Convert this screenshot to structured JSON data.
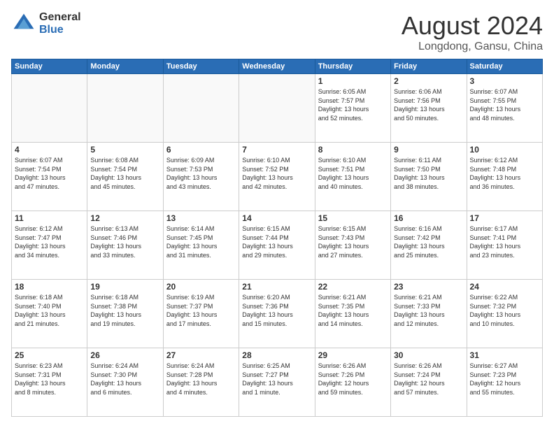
{
  "logo": {
    "general": "General",
    "blue": "Blue"
  },
  "header": {
    "month": "August 2024",
    "location": "Longdong, Gansu, China"
  },
  "weekdays": [
    "Sunday",
    "Monday",
    "Tuesday",
    "Wednesday",
    "Thursday",
    "Friday",
    "Saturday"
  ],
  "weeks": [
    [
      {
        "day": "",
        "info": ""
      },
      {
        "day": "",
        "info": ""
      },
      {
        "day": "",
        "info": ""
      },
      {
        "day": "",
        "info": ""
      },
      {
        "day": "1",
        "info": "Sunrise: 6:05 AM\nSunset: 7:57 PM\nDaylight: 13 hours\nand 52 minutes."
      },
      {
        "day": "2",
        "info": "Sunrise: 6:06 AM\nSunset: 7:56 PM\nDaylight: 13 hours\nand 50 minutes."
      },
      {
        "day": "3",
        "info": "Sunrise: 6:07 AM\nSunset: 7:55 PM\nDaylight: 13 hours\nand 48 minutes."
      }
    ],
    [
      {
        "day": "4",
        "info": "Sunrise: 6:07 AM\nSunset: 7:54 PM\nDaylight: 13 hours\nand 47 minutes."
      },
      {
        "day": "5",
        "info": "Sunrise: 6:08 AM\nSunset: 7:54 PM\nDaylight: 13 hours\nand 45 minutes."
      },
      {
        "day": "6",
        "info": "Sunrise: 6:09 AM\nSunset: 7:53 PM\nDaylight: 13 hours\nand 43 minutes."
      },
      {
        "day": "7",
        "info": "Sunrise: 6:10 AM\nSunset: 7:52 PM\nDaylight: 13 hours\nand 42 minutes."
      },
      {
        "day": "8",
        "info": "Sunrise: 6:10 AM\nSunset: 7:51 PM\nDaylight: 13 hours\nand 40 minutes."
      },
      {
        "day": "9",
        "info": "Sunrise: 6:11 AM\nSunset: 7:50 PM\nDaylight: 13 hours\nand 38 minutes."
      },
      {
        "day": "10",
        "info": "Sunrise: 6:12 AM\nSunset: 7:48 PM\nDaylight: 13 hours\nand 36 minutes."
      }
    ],
    [
      {
        "day": "11",
        "info": "Sunrise: 6:12 AM\nSunset: 7:47 PM\nDaylight: 13 hours\nand 34 minutes."
      },
      {
        "day": "12",
        "info": "Sunrise: 6:13 AM\nSunset: 7:46 PM\nDaylight: 13 hours\nand 33 minutes."
      },
      {
        "day": "13",
        "info": "Sunrise: 6:14 AM\nSunset: 7:45 PM\nDaylight: 13 hours\nand 31 minutes."
      },
      {
        "day": "14",
        "info": "Sunrise: 6:15 AM\nSunset: 7:44 PM\nDaylight: 13 hours\nand 29 minutes."
      },
      {
        "day": "15",
        "info": "Sunrise: 6:15 AM\nSunset: 7:43 PM\nDaylight: 13 hours\nand 27 minutes."
      },
      {
        "day": "16",
        "info": "Sunrise: 6:16 AM\nSunset: 7:42 PM\nDaylight: 13 hours\nand 25 minutes."
      },
      {
        "day": "17",
        "info": "Sunrise: 6:17 AM\nSunset: 7:41 PM\nDaylight: 13 hours\nand 23 minutes."
      }
    ],
    [
      {
        "day": "18",
        "info": "Sunrise: 6:18 AM\nSunset: 7:40 PM\nDaylight: 13 hours\nand 21 minutes."
      },
      {
        "day": "19",
        "info": "Sunrise: 6:18 AM\nSunset: 7:38 PM\nDaylight: 13 hours\nand 19 minutes."
      },
      {
        "day": "20",
        "info": "Sunrise: 6:19 AM\nSunset: 7:37 PM\nDaylight: 13 hours\nand 17 minutes."
      },
      {
        "day": "21",
        "info": "Sunrise: 6:20 AM\nSunset: 7:36 PM\nDaylight: 13 hours\nand 15 minutes."
      },
      {
        "day": "22",
        "info": "Sunrise: 6:21 AM\nSunset: 7:35 PM\nDaylight: 13 hours\nand 14 minutes."
      },
      {
        "day": "23",
        "info": "Sunrise: 6:21 AM\nSunset: 7:33 PM\nDaylight: 13 hours\nand 12 minutes."
      },
      {
        "day": "24",
        "info": "Sunrise: 6:22 AM\nSunset: 7:32 PM\nDaylight: 13 hours\nand 10 minutes."
      }
    ],
    [
      {
        "day": "25",
        "info": "Sunrise: 6:23 AM\nSunset: 7:31 PM\nDaylight: 13 hours\nand 8 minutes."
      },
      {
        "day": "26",
        "info": "Sunrise: 6:24 AM\nSunset: 7:30 PM\nDaylight: 13 hours\nand 6 minutes."
      },
      {
        "day": "27",
        "info": "Sunrise: 6:24 AM\nSunset: 7:28 PM\nDaylight: 13 hours\nand 4 minutes."
      },
      {
        "day": "28",
        "info": "Sunrise: 6:25 AM\nSunset: 7:27 PM\nDaylight: 13 hours\nand 1 minute."
      },
      {
        "day": "29",
        "info": "Sunrise: 6:26 AM\nSunset: 7:26 PM\nDaylight: 12 hours\nand 59 minutes."
      },
      {
        "day": "30",
        "info": "Sunrise: 6:26 AM\nSunset: 7:24 PM\nDaylight: 12 hours\nand 57 minutes."
      },
      {
        "day": "31",
        "info": "Sunrise: 6:27 AM\nSunset: 7:23 PM\nDaylight: 12 hours\nand 55 minutes."
      }
    ]
  ]
}
